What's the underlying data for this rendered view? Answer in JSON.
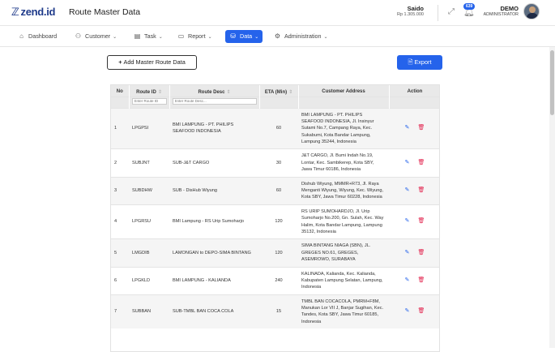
{
  "app": {
    "logo": "zend.id",
    "page_title": "Route Master Data"
  },
  "user": {
    "name": "Saido",
    "balance": "Rp 1.305.000",
    "notifications": "639",
    "display_name": "DEMO",
    "role": "ADMINISTRATOR"
  },
  "nav": [
    {
      "label": "Dashboard",
      "icon": "home-icon",
      "has_menu": false
    },
    {
      "label": "Customer",
      "icon": "users-icon",
      "has_menu": true
    },
    {
      "label": "Task",
      "icon": "clipboard-icon",
      "has_menu": true
    },
    {
      "label": "Report",
      "icon": "folder-icon",
      "has_menu": true
    },
    {
      "label": "Data",
      "icon": "database-icon",
      "has_menu": true,
      "active": true
    },
    {
      "label": "Administration",
      "icon": "gear-icon",
      "has_menu": true
    }
  ],
  "toolbar": {
    "add_label": "Add Master Route Data",
    "export_label": "Export"
  },
  "table": {
    "headers": [
      "No",
      "Route ID",
      "Route Desc",
      "ETA (Min)",
      "Customer Address",
      "Action"
    ],
    "filters": {
      "route_id_placeholder": "Enter Route ID",
      "route_desc_placeholder": "Enter Route Desc..."
    },
    "rows": [
      {
        "no": "1",
        "route_id": "LPGPSI",
        "route_desc": "BMI LAMPUNG - PT. PHILIPS SEAFOOD INDONESIA",
        "eta": "60",
        "address": "BMI LAMPUNG - PT. PHILIPS SEAFOOD INDONESIA, Jl. Insinyur Sutami No.7, Campang Raya, Kec. Sukabumi, Kota Bandar Lampung, Lampung 35244, Indonesia"
      },
      {
        "no": "2",
        "route_id": "SUBJNT",
        "route_desc": "SUB-J&T CARGO",
        "eta": "30",
        "address": "J&T CARGO, Jl. Bumi Indah No.19, Lontar, Kec. Sambikerep, Kota SBY, Jawa Timur 60186, Indonesia"
      },
      {
        "no": "3",
        "route_id": "SUBDHW",
        "route_desc": "SUB - DisHub Wiyung",
        "eta": "60",
        "address": "Dishub Wiyung, MMMR+R73, Jl. Raya Menganti Wiyung, Wiyung, Kec. Wiyung, Kota SBY, Jawa Timur 60228, Indonesia"
      },
      {
        "no": "4",
        "route_id": "LPGRSU",
        "route_desc": "BMI Lampung - RS Urip Sumoharjo",
        "eta": "120",
        "address": "RS URIP SUMOHARDJO, Jl. Urip Sumoharjo No.200, Gn. Sulah, Kec. Way Halim, Kota Bandar Lampung, Lampung 35132, Indonesia"
      },
      {
        "no": "5",
        "route_id": "LMGDIB",
        "route_desc": "LAMONGAN to DEPO-SIMA BINTANG",
        "eta": "120",
        "address": "SIMA BINTANG NIAGA (SBN), JL. GREGES NO.61, GREGES, ASEMROWO, SURABAYA"
      },
      {
        "no": "6",
        "route_id": "LPGKLD",
        "route_desc": "BMI LAMPUNG - KALIANDA",
        "eta": "240",
        "address": "KALINADA, Kalianda, Kec. Kalianda, Kabupaten Lampung Selatan, Lampung, Indonesia"
      },
      {
        "no": "7",
        "route_id": "SUBBAN",
        "route_desc": "SUB-TMBL BAN COCA COLA",
        "eta": "15",
        "address": "TMBL BAN COCACOLA, PMRM+F8M, Manukan Lor VII J, Banjar Sugihan, Kec. Tandes, Kota SBY, Jawa Timur 60185, Indonesia"
      }
    ]
  },
  "colors": {
    "primary": "#2563eb",
    "danger": "#e11d48",
    "header_bg": "#e9e9e9"
  }
}
